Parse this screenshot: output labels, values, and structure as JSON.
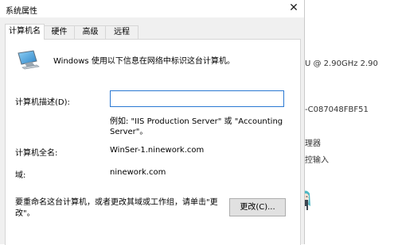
{
  "background": {
    "line1": "U @ 2.90GHz   2.90",
    "line2": "-C087048FBF51",
    "line3": "理器",
    "line4": "控输入"
  },
  "dialog": {
    "title": "系统属性",
    "close_glyph": "✕",
    "tabs": [
      {
        "label": "计算机名"
      },
      {
        "label": "硬件"
      },
      {
        "label": "高级"
      },
      {
        "label": "远程"
      }
    ],
    "intro": "Windows 使用以下信息在网络中标识这台计算机。",
    "desc_label": "计算机描述(D):",
    "desc_value": "",
    "example": "例如: \"IIS Production Server\" 或 \"Accounting Server\"。",
    "fullname_label": "计算机全名:",
    "fullname_value": "WinSer-1.ninework.com",
    "domain_label": "域:",
    "domain_value": "ninework.com",
    "rename_text": "要重命名这台计算机，或者更改其域或工作组，请单击\"更改\"。",
    "change_button": "更改(C)..."
  },
  "colors": {
    "accent": "#2a78d2",
    "dialog_bg": "#f0f0f0",
    "panel_bg": "#ffffff"
  },
  "icons": {
    "computer": "computer-icon",
    "close": "close-icon",
    "character": "anime-character-icon"
  }
}
